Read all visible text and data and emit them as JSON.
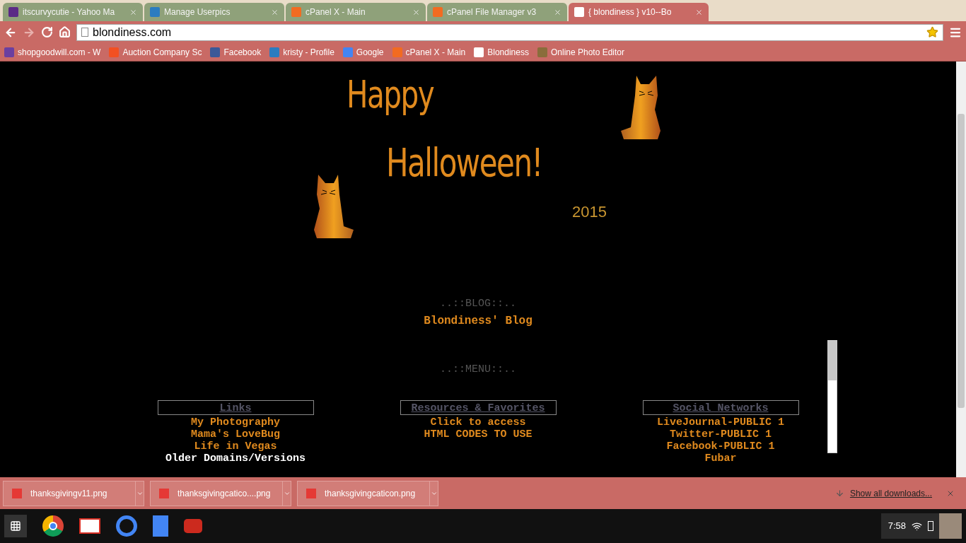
{
  "browser": {
    "tabs": [
      {
        "title": "itscurvycutie - Yahoo Ma",
        "selected": false
      },
      {
        "title": "Manage Userpics",
        "selected": false
      },
      {
        "title": "cPanel X - Main",
        "selected": false
      },
      {
        "title": "cPanel File Manager v3",
        "selected": false
      },
      {
        "title": "{    blondiness    } v10--Bo",
        "selected": true
      }
    ],
    "address": "blondiness.com",
    "bookmarks": [
      {
        "label": "shopgoodwill.com - W"
      },
      {
        "label": "Auction Company Sc"
      },
      {
        "label": "Facebook"
      },
      {
        "label": "kristy - Profile"
      },
      {
        "label": "Google"
      },
      {
        "label": "cPanel X - Main"
      },
      {
        "label": "Blondiness"
      },
      {
        "label": "Online Photo Editor"
      }
    ]
  },
  "page": {
    "banner": {
      "line1": "Happy",
      "line2": "Halloween!",
      "year": "2015"
    },
    "blog": {
      "heading": "..::BLOG::..",
      "link": "Blondiness' Blog"
    },
    "menu": {
      "heading": "..::MENU::..",
      "columns": [
        {
          "title": "Links",
          "items": [
            {
              "label": "My Photography",
              "highlighted": false
            },
            {
              "label": "Mama's LoveBug",
              "highlighted": false
            },
            {
              "label": "Life in Vegas",
              "highlighted": false
            },
            {
              "label": "Older Domains/Versions",
              "highlighted": true
            }
          ]
        },
        {
          "title": "Resources & Favorites",
          "items": [
            {
              "label": "Click to access",
              "highlighted": false
            },
            {
              "label": "HTML CODES TO USE",
              "highlighted": false
            }
          ]
        },
        {
          "title": "Social Networks",
          "items": [
            {
              "label": "LiveJournal-PUBLIC 1",
              "highlighted": false
            },
            {
              "label": "Twitter-PUBLIC 1",
              "highlighted": false
            },
            {
              "label": "Facebook-PUBLIC 1",
              "highlighted": false
            },
            {
              "label": "Fubar",
              "highlighted": false
            }
          ]
        }
      ]
    }
  },
  "downloads": {
    "items": [
      {
        "name": "thanksgivingv11.png"
      },
      {
        "name": "thanksgivingcatico....png"
      },
      {
        "name": "thanksgivingcaticon.png"
      }
    ],
    "show_all": "Show all downloads..."
  },
  "shelf": {
    "time": "7:58"
  }
}
